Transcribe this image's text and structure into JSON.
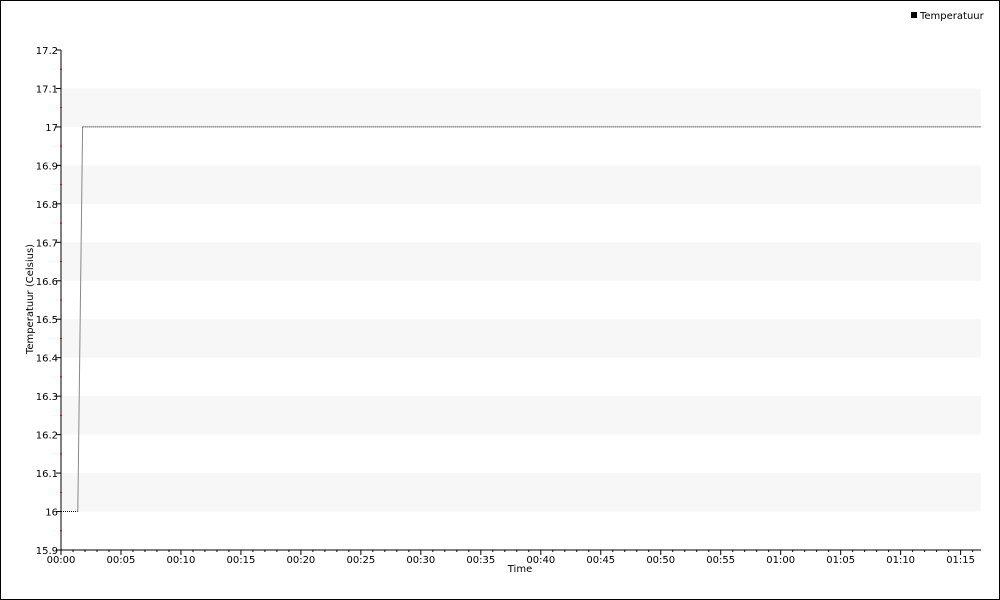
{
  "chart_data": {
    "type": "line",
    "xlabel": "Time",
    "ylabel": "Temperatuur (Celsius)",
    "ylim": [
      15.9,
      17.2
    ],
    "y_ticks": [
      "15.9",
      "16",
      "16.1",
      "16.2",
      "16.3",
      "16.4",
      "16.5",
      "16.6",
      "16.7",
      "16.8",
      "16.9",
      "17",
      "17.1",
      "17.2"
    ],
    "x_ticks": [
      "00:00",
      "00:05",
      "00:10",
      "00:15",
      "00:20",
      "00:25",
      "00:30",
      "00:35",
      "00:40",
      "00:45",
      "00:50",
      "00:55",
      "01:00",
      "01:05",
      "01:10",
      "01:15"
    ],
    "xlim_minutes": [
      0,
      76.7
    ],
    "grid": "alternating horizontal bands",
    "legend": {
      "position": "top-right",
      "entries": [
        "Temperatuur"
      ]
    },
    "series": [
      {
        "name": "Temperatuur",
        "color": "#000000",
        "points": [
          {
            "t": "00:00",
            "y": 16
          },
          {
            "t": "00:01.4",
            "y": 16
          },
          {
            "t": "00:01.8",
            "y": 17
          },
          {
            "t": "01:16.7",
            "y": 17
          }
        ]
      }
    ]
  },
  "colors": {
    "band": "#f7f7f7",
    "axis": "#000000",
    "minor_tick": "#cc0000",
    "line": "#000000",
    "step": "#888888"
  }
}
